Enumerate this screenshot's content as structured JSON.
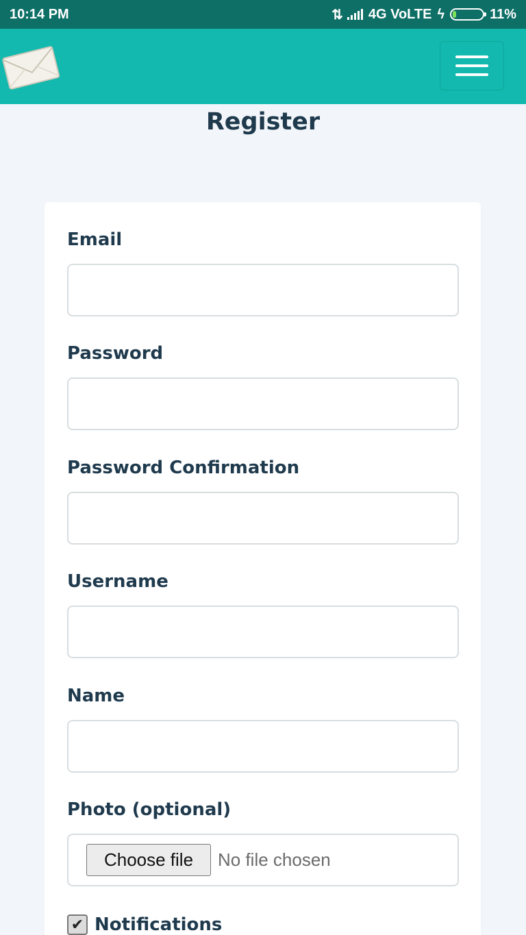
{
  "status_bar": {
    "time": "10:14 PM",
    "network": "4G VoLTE",
    "battery": "11%",
    "battery_level": 0.11
  },
  "header": {
    "logo_icon": "envelope-icon",
    "menu_icon": "hamburger-menu-icon"
  },
  "page": {
    "title": "Register"
  },
  "form": {
    "fields": [
      {
        "label": "Email",
        "value": ""
      },
      {
        "label": "Password",
        "value": ""
      },
      {
        "label": "Password Confirmation",
        "value": ""
      },
      {
        "label": "Username",
        "value": ""
      },
      {
        "label": "Name",
        "value": ""
      }
    ],
    "photo": {
      "label": "Photo (optional)",
      "button_label": "Choose file",
      "status": "No file chosen"
    },
    "notifications": {
      "label": "Notifications",
      "checked": true
    }
  },
  "colors": {
    "status_bar": "#0d6f66",
    "header": "#13b9ae",
    "background": "#f2f6fa",
    "label_text": "#1f3a4d"
  }
}
